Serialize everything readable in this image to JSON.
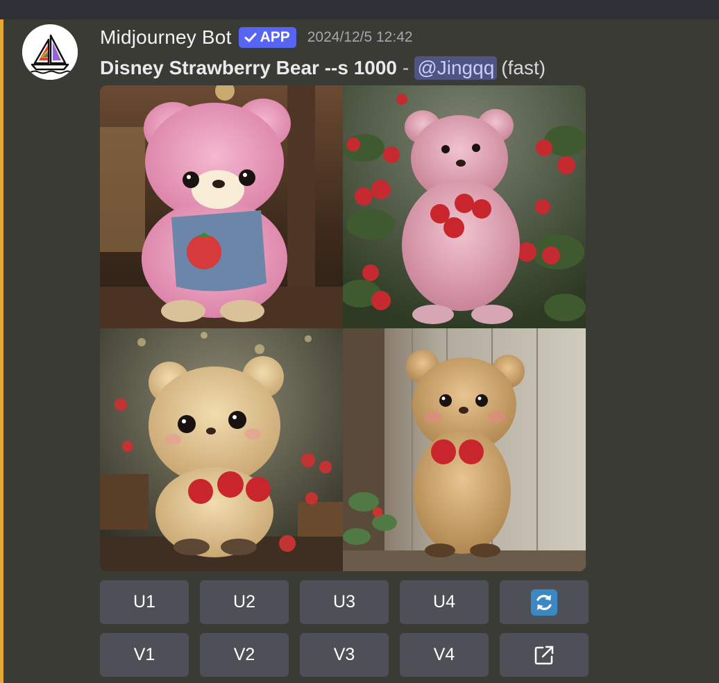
{
  "message": {
    "username": "Midjourney Bot",
    "badge": "APP",
    "timestamp": "2024/12/5 12:42",
    "prompt": "Disney Strawberry Bear --s 1000",
    "separator": "-",
    "mention": "@Jingqq",
    "speed": "(fast)"
  },
  "images": [
    {
      "icon": "pink-bear-overalls-image"
    },
    {
      "icon": "pink-bear-strawberry-bush-image"
    },
    {
      "icon": "tan-bear-strawberries-image"
    },
    {
      "icon": "brown-bear-wooden-door-image"
    }
  ],
  "buttons": {
    "row1": [
      "U1",
      "U2",
      "U3",
      "U4"
    ],
    "row2": [
      "V1",
      "V2",
      "V3",
      "V4"
    ],
    "reroll_icon": "reroll-icon",
    "web_icon": "external-link-icon"
  },
  "colors": {
    "badge": "#5865f2",
    "highlight": "#e3a82f",
    "button": "#4e5058",
    "reroll": "#3b88c3"
  }
}
